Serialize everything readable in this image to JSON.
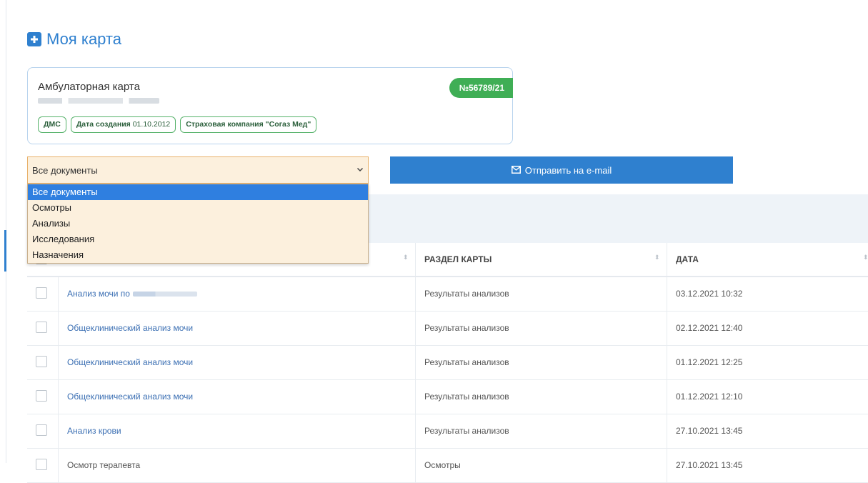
{
  "page": {
    "title": "Моя карта"
  },
  "card": {
    "title": "Амбулаторная карта",
    "number": "№56789/21",
    "tags": [
      {
        "label": "ДМС"
      },
      {
        "label": "Дата создания",
        "value": "01.10.2012"
      },
      {
        "label": "Страховая компания \"Согаз Мед\""
      }
    ]
  },
  "filter": {
    "selected": "Все документы",
    "options": [
      "Все документы",
      "Осмотры",
      "Анализы",
      "Исследования",
      "Назначения"
    ]
  },
  "email_button": {
    "label": "Отправить на e-mail"
  },
  "table": {
    "columns": [
      "РАЗДЕЛ КАРТЫ",
      "ДАТА"
    ],
    "rows": [
      {
        "name": "Анализ мочи по",
        "name_blurred": true,
        "section": "Результаты анализов",
        "date": "03.12.2021 10:32",
        "link": true
      },
      {
        "name": "Общеклинический анализ мочи",
        "section": "Результаты анализов",
        "date": "02.12.2021 12:40",
        "link": true
      },
      {
        "name": "Общеклинический анализ мочи",
        "section": "Результаты анализов",
        "date": "01.12.2021 12:25",
        "link": true
      },
      {
        "name": "Общеклинический анализ мочи",
        "section": "Результаты анализов",
        "date": "01.12.2021 12:10",
        "link": true
      },
      {
        "name": "Анализ крови",
        "section": "Результаты анализов",
        "date": "27.10.2021 13:45",
        "link": true
      },
      {
        "name": "Осмотр терапевта",
        "section": "Осмотры",
        "date": "27.10.2021 13:45",
        "link": false
      }
    ]
  },
  "colors": {
    "accent": "#2f80cf",
    "badge": "#3fae55",
    "select_bg": "#fcf0dd",
    "option_selected": "#2f7fe0"
  }
}
